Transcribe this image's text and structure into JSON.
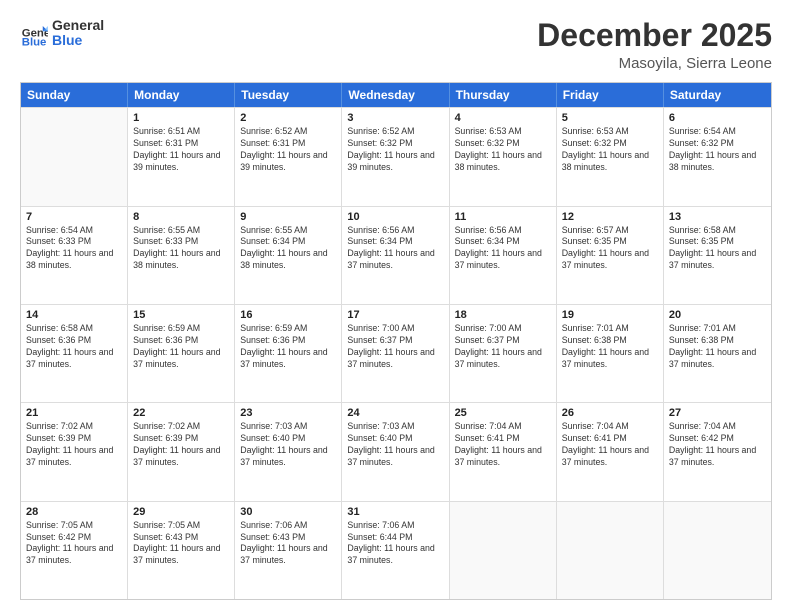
{
  "header": {
    "logo_general": "General",
    "logo_blue": "Blue",
    "month": "December 2025",
    "location": "Masoyila, Sierra Leone"
  },
  "weekdays": [
    "Sunday",
    "Monday",
    "Tuesday",
    "Wednesday",
    "Thursday",
    "Friday",
    "Saturday"
  ],
  "rows": [
    [
      {
        "day": "",
        "empty": true
      },
      {
        "day": "1",
        "sunrise": "Sunrise: 6:51 AM",
        "sunset": "Sunset: 6:31 PM",
        "daylight": "Daylight: 11 hours and 39 minutes."
      },
      {
        "day": "2",
        "sunrise": "Sunrise: 6:52 AM",
        "sunset": "Sunset: 6:31 PM",
        "daylight": "Daylight: 11 hours and 39 minutes."
      },
      {
        "day": "3",
        "sunrise": "Sunrise: 6:52 AM",
        "sunset": "Sunset: 6:32 PM",
        "daylight": "Daylight: 11 hours and 39 minutes."
      },
      {
        "day": "4",
        "sunrise": "Sunrise: 6:53 AM",
        "sunset": "Sunset: 6:32 PM",
        "daylight": "Daylight: 11 hours and 38 minutes."
      },
      {
        "day": "5",
        "sunrise": "Sunrise: 6:53 AM",
        "sunset": "Sunset: 6:32 PM",
        "daylight": "Daylight: 11 hours and 38 minutes."
      },
      {
        "day": "6",
        "sunrise": "Sunrise: 6:54 AM",
        "sunset": "Sunset: 6:32 PM",
        "daylight": "Daylight: 11 hours and 38 minutes."
      }
    ],
    [
      {
        "day": "7",
        "sunrise": "Sunrise: 6:54 AM",
        "sunset": "Sunset: 6:33 PM",
        "daylight": "Daylight: 11 hours and 38 minutes."
      },
      {
        "day": "8",
        "sunrise": "Sunrise: 6:55 AM",
        "sunset": "Sunset: 6:33 PM",
        "daylight": "Daylight: 11 hours and 38 minutes."
      },
      {
        "day": "9",
        "sunrise": "Sunrise: 6:55 AM",
        "sunset": "Sunset: 6:34 PM",
        "daylight": "Daylight: 11 hours and 38 minutes."
      },
      {
        "day": "10",
        "sunrise": "Sunrise: 6:56 AM",
        "sunset": "Sunset: 6:34 PM",
        "daylight": "Daylight: 11 hours and 37 minutes."
      },
      {
        "day": "11",
        "sunrise": "Sunrise: 6:56 AM",
        "sunset": "Sunset: 6:34 PM",
        "daylight": "Daylight: 11 hours and 37 minutes."
      },
      {
        "day": "12",
        "sunrise": "Sunrise: 6:57 AM",
        "sunset": "Sunset: 6:35 PM",
        "daylight": "Daylight: 11 hours and 37 minutes."
      },
      {
        "day": "13",
        "sunrise": "Sunrise: 6:58 AM",
        "sunset": "Sunset: 6:35 PM",
        "daylight": "Daylight: 11 hours and 37 minutes."
      }
    ],
    [
      {
        "day": "14",
        "sunrise": "Sunrise: 6:58 AM",
        "sunset": "Sunset: 6:36 PM",
        "daylight": "Daylight: 11 hours and 37 minutes."
      },
      {
        "day": "15",
        "sunrise": "Sunrise: 6:59 AM",
        "sunset": "Sunset: 6:36 PM",
        "daylight": "Daylight: 11 hours and 37 minutes."
      },
      {
        "day": "16",
        "sunrise": "Sunrise: 6:59 AM",
        "sunset": "Sunset: 6:36 PM",
        "daylight": "Daylight: 11 hours and 37 minutes."
      },
      {
        "day": "17",
        "sunrise": "Sunrise: 7:00 AM",
        "sunset": "Sunset: 6:37 PM",
        "daylight": "Daylight: 11 hours and 37 minutes."
      },
      {
        "day": "18",
        "sunrise": "Sunrise: 7:00 AM",
        "sunset": "Sunset: 6:37 PM",
        "daylight": "Daylight: 11 hours and 37 minutes."
      },
      {
        "day": "19",
        "sunrise": "Sunrise: 7:01 AM",
        "sunset": "Sunset: 6:38 PM",
        "daylight": "Daylight: 11 hours and 37 minutes."
      },
      {
        "day": "20",
        "sunrise": "Sunrise: 7:01 AM",
        "sunset": "Sunset: 6:38 PM",
        "daylight": "Daylight: 11 hours and 37 minutes."
      }
    ],
    [
      {
        "day": "21",
        "sunrise": "Sunrise: 7:02 AM",
        "sunset": "Sunset: 6:39 PM",
        "daylight": "Daylight: 11 hours and 37 minutes."
      },
      {
        "day": "22",
        "sunrise": "Sunrise: 7:02 AM",
        "sunset": "Sunset: 6:39 PM",
        "daylight": "Daylight: 11 hours and 37 minutes."
      },
      {
        "day": "23",
        "sunrise": "Sunrise: 7:03 AM",
        "sunset": "Sunset: 6:40 PM",
        "daylight": "Daylight: 11 hours and 37 minutes."
      },
      {
        "day": "24",
        "sunrise": "Sunrise: 7:03 AM",
        "sunset": "Sunset: 6:40 PM",
        "daylight": "Daylight: 11 hours and 37 minutes."
      },
      {
        "day": "25",
        "sunrise": "Sunrise: 7:04 AM",
        "sunset": "Sunset: 6:41 PM",
        "daylight": "Daylight: 11 hours and 37 minutes."
      },
      {
        "day": "26",
        "sunrise": "Sunrise: 7:04 AM",
        "sunset": "Sunset: 6:41 PM",
        "daylight": "Daylight: 11 hours and 37 minutes."
      },
      {
        "day": "27",
        "sunrise": "Sunrise: 7:04 AM",
        "sunset": "Sunset: 6:42 PM",
        "daylight": "Daylight: 11 hours and 37 minutes."
      }
    ],
    [
      {
        "day": "28",
        "sunrise": "Sunrise: 7:05 AM",
        "sunset": "Sunset: 6:42 PM",
        "daylight": "Daylight: 11 hours and 37 minutes."
      },
      {
        "day": "29",
        "sunrise": "Sunrise: 7:05 AM",
        "sunset": "Sunset: 6:43 PM",
        "daylight": "Daylight: 11 hours and 37 minutes."
      },
      {
        "day": "30",
        "sunrise": "Sunrise: 7:06 AM",
        "sunset": "Sunset: 6:43 PM",
        "daylight": "Daylight: 11 hours and 37 minutes."
      },
      {
        "day": "31",
        "sunrise": "Sunrise: 7:06 AM",
        "sunset": "Sunset: 6:44 PM",
        "daylight": "Daylight: 11 hours and 37 minutes."
      },
      {
        "day": "",
        "empty": true
      },
      {
        "day": "",
        "empty": true
      },
      {
        "day": "",
        "empty": true
      }
    ]
  ]
}
